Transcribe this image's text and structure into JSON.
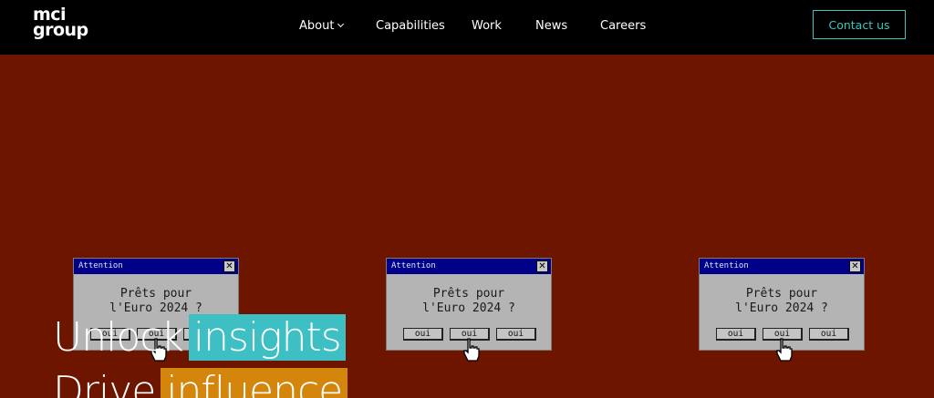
{
  "logo": {
    "line1": "mci",
    "line2": "group"
  },
  "nav": {
    "items": [
      {
        "label": "About",
        "has_dropdown": true
      },
      {
        "label": "Capabilities"
      },
      {
        "label": "Work"
      },
      {
        "label": "News"
      },
      {
        "label": "Careers"
      }
    ],
    "contact_label": "Contact us"
  },
  "hero": {
    "line1_plain": "Unlock",
    "line1_highlight": "insights",
    "line2_plain": "Drive",
    "line2_highlight": "influence"
  },
  "dialogs": [
    {
      "title": "Attention",
      "close": "✕",
      "line1": "Prêts pour",
      "line2": "l'Euro 2024 ?",
      "buttons": [
        "oui",
        "oui",
        "oui"
      ]
    },
    {
      "title": "Attention",
      "close": "✕",
      "line1": "Prêts pour",
      "line2": "l'Euro 2024 ?",
      "buttons": [
        "oui",
        "oui",
        "oui"
      ]
    },
    {
      "title": "Attention",
      "close": "✕",
      "line1": "Prêts pour",
      "line2": "l'Euro 2024 ?",
      "buttons": [
        "oui",
        "oui",
        "oui"
      ]
    }
  ],
  "colors": {
    "background": "#6e1500",
    "navbar": "#000000",
    "accent_teal": "#3ebfc4",
    "accent_orange": "#d4860c"
  }
}
